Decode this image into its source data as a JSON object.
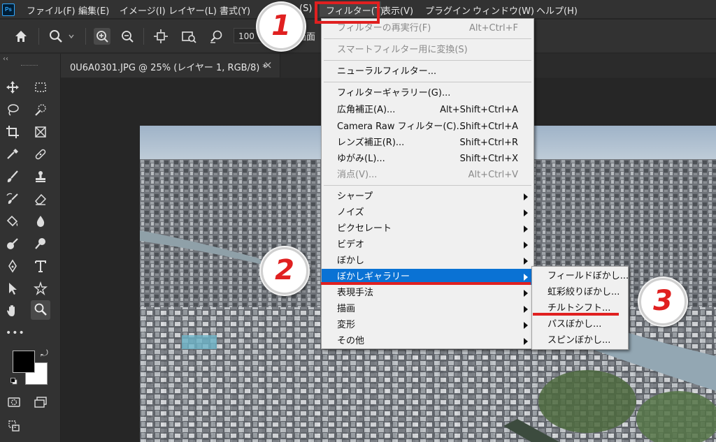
{
  "app": {
    "logo_text": "Ps"
  },
  "menubar": {
    "items": [
      "ファイル(F)",
      "編集(E)",
      "イメージ(I)",
      "レイヤー(L)",
      "書式(Y)",
      "選択範囲(S)",
      "フィルター(T)",
      "表示(V)",
      "プラグイン",
      "ウィンドウ(W)",
      "ヘルプ(H)"
    ],
    "visible_fragments": {
      "select_tail": "(S)",
      "select_head": "選"
    }
  },
  "options_bar": {
    "zoom_value": "100",
    "fit_screen_label": "画面",
    "icons": [
      "home-icon",
      "zoom-tool-icon",
      "zoom-in-icon",
      "zoom-out-icon",
      "move-view-icon",
      "fit-screen-icon",
      "scrubby-zoom-icon"
    ]
  },
  "document": {
    "tab_label": "0U6A0301.JPG @ 25% (レイヤー 1, RGB/8) *",
    "close_symbol": "×"
  },
  "filter_menu": {
    "items": [
      {
        "label": "フィルターの再実行(F)",
        "shortcut": "Alt+Ctrl+F",
        "disabled": true
      },
      {
        "label": "スマートフィルター用に変換(S)",
        "shortcut": "",
        "disabled": true
      },
      {
        "label": "ニューラルフィルター...",
        "shortcut": ""
      },
      {
        "label": "フィルターギャラリー(G)...",
        "shortcut": ""
      },
      {
        "label": "広角補正(A)...",
        "shortcut": "Alt+Shift+Ctrl+A"
      },
      {
        "label": "Camera Raw フィルター(C)...",
        "shortcut": "Shift+Ctrl+A"
      },
      {
        "label": "レンズ補正(R)...",
        "shortcut": "Shift+Ctrl+R"
      },
      {
        "label": "ゆがみ(L)...",
        "shortcut": "Shift+Ctrl+X"
      },
      {
        "label": "消点(V)...",
        "shortcut": "Alt+Ctrl+V",
        "disabled": true
      },
      {
        "label": "シャープ",
        "submenu": true
      },
      {
        "label": "ノイズ",
        "submenu": true
      },
      {
        "label": "ピクセレート",
        "submenu": true
      },
      {
        "label": "ビデオ",
        "submenu": true
      },
      {
        "label": "ぼかし",
        "submenu": true
      },
      {
        "label": "ぼかしギャラリー",
        "submenu": true,
        "highlighted": true
      },
      {
        "label": "表現手法",
        "submenu": true
      },
      {
        "label": "描画",
        "submenu": true
      },
      {
        "label": "変形",
        "submenu": true
      },
      {
        "label": "その他",
        "submenu": true
      }
    ]
  },
  "blur_gallery_submenu": {
    "items": [
      "フィールドぼかし...",
      "虹彩絞りぼかし...",
      "チルトシフト...",
      "パスぼかし...",
      "スピンぼかし..."
    ]
  },
  "annotations": {
    "step1": "1",
    "step2": "2",
    "step3": "3",
    "accent_color": "#e02020"
  },
  "colors": {
    "foreground": "#000000",
    "background": "#ffffff",
    "highlight": "#0a72d4"
  }
}
